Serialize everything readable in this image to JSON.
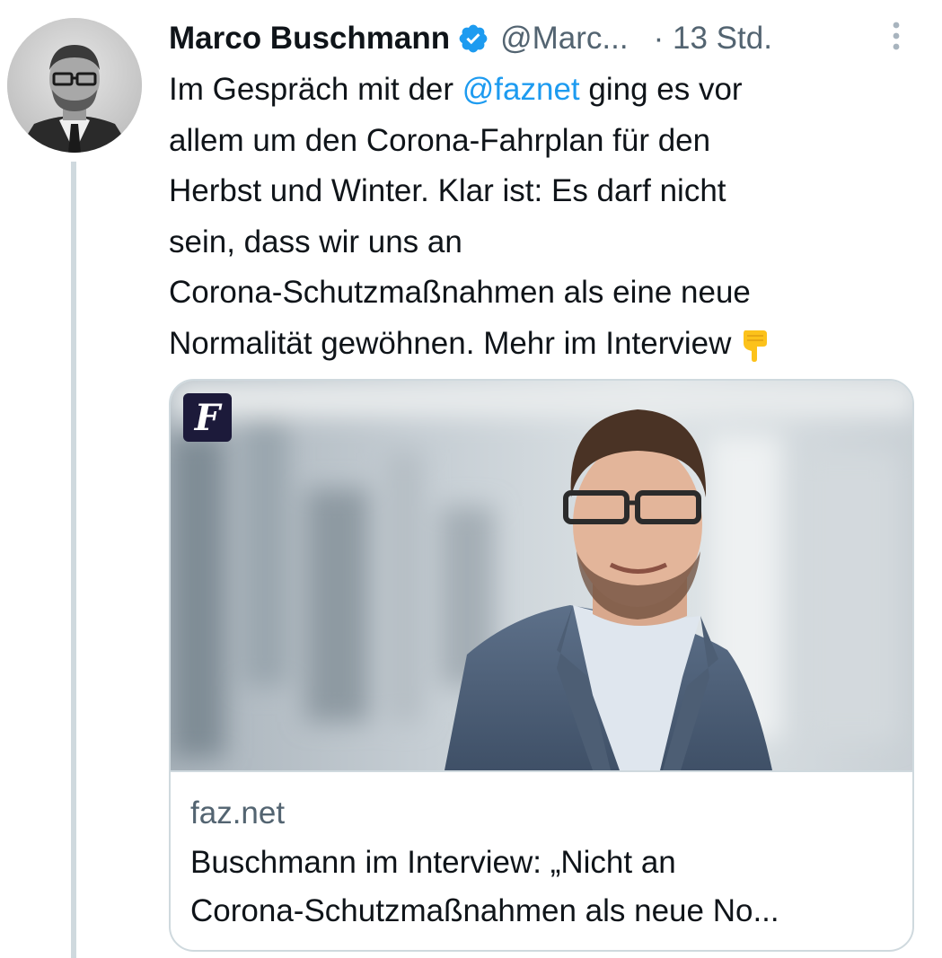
{
  "tweet": {
    "author": {
      "display_name": "Marco Buschmann",
      "handle": "@Marc...",
      "verified": true,
      "avatar_icon": "profile-photo"
    },
    "time_separator": "·",
    "timestamp": "13 Std.",
    "more_icon": "more-vertical-icon",
    "text": {
      "line1_prefix": "Im Gespräch mit der ",
      "mention": "@faznet",
      "line1_suffix": " ging es vor",
      "line2": "allem um den Corona-Fahrplan für den",
      "line3": "Herbst und Winter. Klar ist: Es darf nicht",
      "line4": "sein, dass wir uns an",
      "line5": "Corona-Schutzmaßnahmen als eine neue",
      "line6": "Normalität gewöhnen. Mehr im Interview",
      "emoji": "pointing-down-hand-emoji"
    },
    "card": {
      "domain": "faz.net",
      "title_line1": "Buschmann im Interview: „Nicht an",
      "title_line2": "Corona-Schutzmaßnahmen als neue No...",
      "logo_letter": "F",
      "logo_icon": "faz-logo"
    }
  },
  "colors": {
    "text_primary": "#0f1419",
    "text_secondary": "#536471",
    "link_blue": "#1d9bf0",
    "border": "#cfd9de",
    "verified_blue": "#1d9bf0",
    "faz_logo_bg": "#1c1a3a"
  }
}
